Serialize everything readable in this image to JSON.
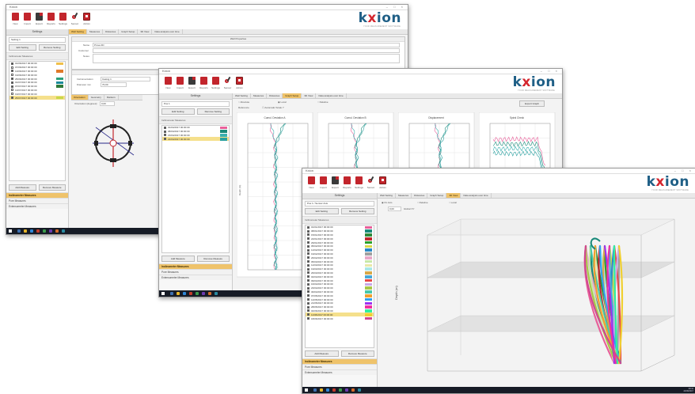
{
  "brand": {
    "logo_pre": "k",
    "logo_x": "x",
    "logo_post": "ion",
    "slogan": "YOUR MEASUREMENT SOFTWARE",
    "accent": "#efc36b",
    "red": "#c2252c",
    "blue": "#1f5f86"
  },
  "toolbar": {
    "buttons": [
      {
        "label": "New",
        "icon": "new-file-icon"
      },
      {
        "label": "Import",
        "icon": "import-icon"
      },
      {
        "label": "Export",
        "icon": "export-icon"
      },
      {
        "label": "Reports",
        "icon": "reports-icon"
      },
      {
        "label": "Settings",
        "icon": "settings-icon"
      },
      {
        "label": "Sensor",
        "icon": "sensor-icon"
      },
      {
        "label": "Admin",
        "icon": "admin-icon"
      }
    ]
  },
  "win1": {
    "title": "Kxion",
    "sidebar_header": "Settings",
    "setting_field": "Setting 1",
    "btn_edit_setting": "Edit Setting",
    "btn_remove_setting": "Remove Setting",
    "list_header": "Inclinometer Measures",
    "items": [
      {
        "text": "01/06/2017 00:00:00",
        "color": "#f0c04a",
        "checked": true
      },
      {
        "text": "07/06/2017 00:00:00",
        "color": "",
        "checked": false
      },
      {
        "text": "13/06/2017 00:00:00",
        "color": "#e07a2a",
        "checked": true
      },
      {
        "text": "19/06/2017 00:00:00",
        "color": "",
        "checked": false
      },
      {
        "text": "25/06/2017 00:00:00",
        "color": "#2aa07a",
        "checked": true
      },
      {
        "text": "01/07/2017 00:00:00",
        "color": "#1a8a9a",
        "checked": true
      },
      {
        "text": "07/07/2017 00:00:00",
        "color": "#2f7a3a",
        "checked": true
      },
      {
        "text": "13/07/2017 00:00:00",
        "color": "",
        "checked": false
      },
      {
        "text": "19/07/2017 00:00:00",
        "color": "",
        "checked": false
      },
      {
        "text": "25/07/2017 00:00:00",
        "color": "#c8d84a",
        "checked": true,
        "selected": true
      }
    ],
    "btn_add": "Add Measure",
    "btn_remove": "Remove Measure",
    "sections": [
      "Inclinometer Measures",
      "Pore Measures",
      "Extensometer Measures"
    ],
    "tabs": [
      "Well Setting",
      "Measures",
      "Distances",
      "Graph Setup",
      "3D View",
      "Data analysis over time"
    ],
    "group_header": "Well Properties",
    "field_labels": [
      "Name",
      "Customer",
      "Notes"
    ],
    "name_value": "Prova 3D",
    "group2_header": "Casing Properties",
    "casing_labels": [
      "Instrumentation",
      "Diameter mm"
    ],
    "casing_values": [
      "Casing 1",
      "70,00"
    ],
    "subtabs": [
      "Orientation",
      "Geometry",
      "Markers"
    ],
    "orientation_label": "Orientation (degrees):",
    "orientation_value": "0,00"
  },
  "win2": {
    "title": "Kxion",
    "sidebar_header": "Settings",
    "setting_field": "Pos 1",
    "btn_edit_setting": "Edit Setting",
    "btn_remove_setting": "Remove Setting",
    "list_header": "Inclinometer Measures",
    "items": [
      {
        "text": "01/04/2017 00:00:00",
        "color": "#e8609a",
        "checked": true
      },
      {
        "text": "08/04/2017 00:00:00",
        "color": "#1a8a7a",
        "checked": true
      },
      {
        "text": "15/04/2017 00:00:00",
        "color": "#3ab0b0",
        "checked": true
      },
      {
        "text": "22/04/2017 00:00:00",
        "color": "#2aa0a0",
        "checked": true,
        "selected": true
      }
    ],
    "btn_add": "Add Measure",
    "btn_remove": "Remove Measure",
    "sections": [
      "Inclinometer Measures",
      "Pore Measures",
      "Extensometer Measures"
    ],
    "tabs": [
      "Well Setting",
      "Measures",
      "Distances",
      "Graph Setup",
      "3D View",
      "Data analysis over time"
    ],
    "opt_labels": [
      "Absolute",
      "Local",
      "Relative"
    ],
    "ref_label": "Reference",
    "scale_label": "Automatic Scale Y",
    "export_btn": "Export Graph",
    "charts": [
      "Cumul. Deviation A",
      "Cumul. Deviation B",
      "Displacement",
      "Spiral Check"
    ],
    "ylabel": "Depth (m)"
  },
  "win3": {
    "title": "Kxion",
    "sidebar_header": "Settings",
    "setting_field": "Pos 1 / Sensor Axis",
    "btn_edit_setting": "Edit Setting",
    "btn_remove_setting": "Remove Setting",
    "list_header": "Inclinometer Measures",
    "items": [
      {
        "text": "01/01/2017 00:00:00",
        "color": "#e8609a",
        "checked": true
      },
      {
        "text": "08/01/2017 00:00:00",
        "color": "#1a8a7a",
        "checked": true
      },
      {
        "text": "15/01/2017 00:00:00",
        "color": "#2f8a3a",
        "checked": true
      },
      {
        "text": "22/01/2017 00:00:00",
        "color": "#c2252c",
        "checked": true
      },
      {
        "text": "29/01/2017 00:00:00",
        "color": "#2aa02a",
        "checked": true
      },
      {
        "text": "05/02/2017 00:00:00",
        "color": "#d8d84a",
        "checked": true
      },
      {
        "text": "12/02/2017 00:00:00",
        "color": "#2a8ac8",
        "checked": true
      },
      {
        "text": "19/02/2017 00:00:00",
        "color": "#a0a0a0",
        "checked": true
      },
      {
        "text": "26/02/2017 00:00:00",
        "color": "#e8a8c8",
        "checked": true
      },
      {
        "text": "05/03/2017 00:00:00",
        "color": "#c8e8a8",
        "checked": true
      },
      {
        "text": "12/03/2017 00:00:00",
        "color": "#e8e8a8",
        "checked": true
      },
      {
        "text": "19/03/2017 00:00:00",
        "color": "#a8e8e8",
        "checked": true
      },
      {
        "text": "26/03/2017 00:00:00",
        "color": "#d8a848",
        "checked": true
      },
      {
        "text": "02/04/2017 00:00:00",
        "color": "#48a8d8",
        "checked": true
      },
      {
        "text": "09/04/2017 00:00:00",
        "color": "#e84848",
        "checked": true
      },
      {
        "text": "16/04/2017 00:00:00",
        "color": "#c8a8e8",
        "checked": true
      },
      {
        "text": "23/04/2017 00:00:00",
        "color": "#a8c848",
        "checked": true
      },
      {
        "text": "30/04/2017 00:00:00",
        "color": "#48c8a8",
        "checked": true
      },
      {
        "text": "07/05/2017 00:00:00",
        "color": "#f0a030",
        "checked": true
      },
      {
        "text": "14/05/2017 00:00:00",
        "color": "#30a0f0",
        "checked": true
      },
      {
        "text": "21/05/2017 00:00:00",
        "color": "#a030f0",
        "checked": true
      },
      {
        "text": "28/05/2017 00:00:00",
        "color": "#f030a0",
        "checked": true
      },
      {
        "text": "04/06/2017 00:00:00",
        "color": "#30f0a0",
        "checked": true
      },
      {
        "text": "11/06/2017 00:00:00",
        "color": "#f0d030",
        "checked": true,
        "selected": true
      },
      {
        "text": "18/06/2017 00:00:00",
        "color": "#d04890",
        "checked": true
      }
    ],
    "btn_add": "Add Measure",
    "btn_remove": "Remove Measure",
    "sections": [
      "Inclinometer Measures",
      "Pore Measures",
      "Extensometer Measures"
    ],
    "tabs": [
      "Well Setting",
      "Measures",
      "Distances",
      "Graph Setup",
      "3D View",
      "Data analysis over time"
    ],
    "opt_labels": [
      "Po Axis",
      "Relative",
      "Local"
    ],
    "ref_value": "0,00",
    "ref_label": "Global XY",
    "axis_z": "Depth (m)",
    "taskbar_time": "09:41",
    "taskbar_date": "22/06/2017"
  }
}
